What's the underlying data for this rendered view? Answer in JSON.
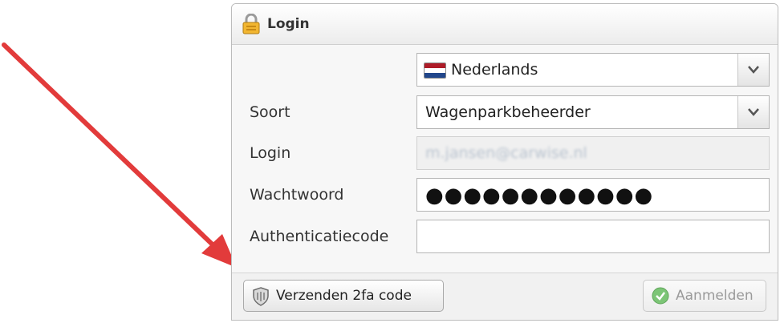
{
  "window": {
    "title": "Login",
    "title_icon": "lock-icon"
  },
  "form": {
    "language": {
      "value": "Nederlands",
      "flag_icon": "netherlands-flag-icon"
    },
    "soort": {
      "label": "Soort",
      "value": "Wagenparkbeheerder"
    },
    "login": {
      "label": "Login",
      "value": "m.jansen@carwise.nl",
      "disabled": true
    },
    "wachtwoord": {
      "label": "Wachtwoord",
      "value": "●●●●●●●●●●●●"
    },
    "authenticatiecode": {
      "label": "Authenticatiecode",
      "value": ""
    }
  },
  "footer": {
    "send_button": {
      "label": "Verzenden 2fa code",
      "icon": "shield-icon"
    },
    "login_button": {
      "label": "Aanmelden",
      "icon": "check-circle-icon",
      "disabled": true
    }
  },
  "colors": {
    "arrow": "#e23b3b",
    "flag_red": "#ae1c28",
    "flag_white": "#ffffff",
    "flag_blue": "#21468b",
    "check_green": "#7cc576"
  }
}
